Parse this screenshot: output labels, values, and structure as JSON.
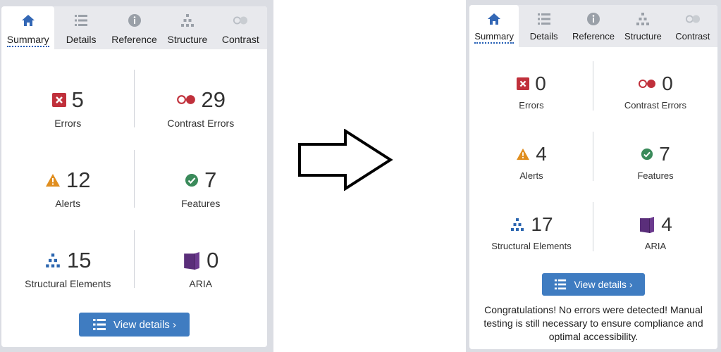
{
  "tabs": [
    {
      "label": "Summary",
      "icon": "home-icon"
    },
    {
      "label": "Details",
      "icon": "list-icon"
    },
    {
      "label": "Reference",
      "icon": "info-icon"
    },
    {
      "label": "Structure",
      "icon": "hierarchy-icon"
    },
    {
      "label": "Contrast",
      "icon": "contrast-icon"
    }
  ],
  "before": {
    "errors": {
      "value": "5",
      "label": "Errors"
    },
    "contrast": {
      "value": "29",
      "label": "Contrast Errors"
    },
    "alerts": {
      "value": "12",
      "label": "Alerts"
    },
    "features": {
      "value": "7",
      "label": "Features"
    },
    "structure": {
      "value": "15",
      "label": "Structural Elements"
    },
    "aria": {
      "value": "0",
      "label": "ARIA"
    },
    "button": "View details ›"
  },
  "after": {
    "errors": {
      "value": "0",
      "label": "Errors"
    },
    "contrast": {
      "value": "0",
      "label": "Contrast Errors"
    },
    "alerts": {
      "value": "4",
      "label": "Alerts"
    },
    "features": {
      "value": "7",
      "label": "Features"
    },
    "structure": {
      "value": "17",
      "label": "Structural Elements"
    },
    "aria": {
      "value": "4",
      "label": "ARIA"
    },
    "button": "View details ›",
    "message": "Congratulations! No errors were detected! Manual testing is still necessary to ensure compliance and optimal accessibility."
  },
  "colors": {
    "accent": "#3f7cc1",
    "error": "#c0303b",
    "alert": "#e08e1f",
    "feature": "#3a8a5a",
    "aria": "#5a2e7a",
    "structure": "#2c66b0"
  }
}
